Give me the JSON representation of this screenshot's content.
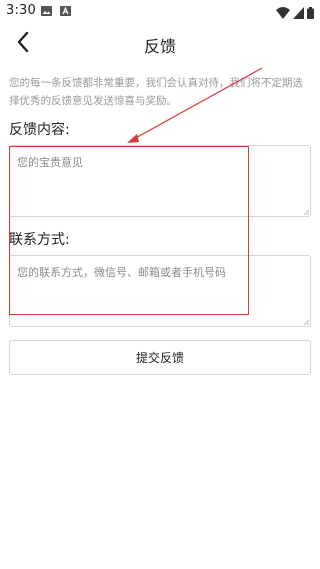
{
  "status_bar": {
    "time": "3:30",
    "notification_icons": [
      "image-icon",
      "a-icon"
    ],
    "system_icons": [
      "wifi-icon",
      "cell-signal-icon",
      "battery-icon"
    ]
  },
  "title_bar": {
    "back_icon": "chevron-left-icon",
    "title": "反馈"
  },
  "intro": {
    "text": "您的每一条反馈都非常重要，我们会认真对待，我们将不定期选择优秀的反馈意见发送惊喜与奖励。"
  },
  "feedback_content": {
    "label": "反馈内容:",
    "placeholder": "您的宝贵意见",
    "value": ""
  },
  "contact": {
    "label": "联系方式:",
    "placeholder": "您的联系方式，微信号、邮箱或者手机号码",
    "value": ""
  },
  "submit": {
    "label": "提交反馈"
  },
  "colors": {
    "annotation": "#d9363e",
    "border": "#d6d6d6",
    "muted_text": "#9a9a9a"
  }
}
